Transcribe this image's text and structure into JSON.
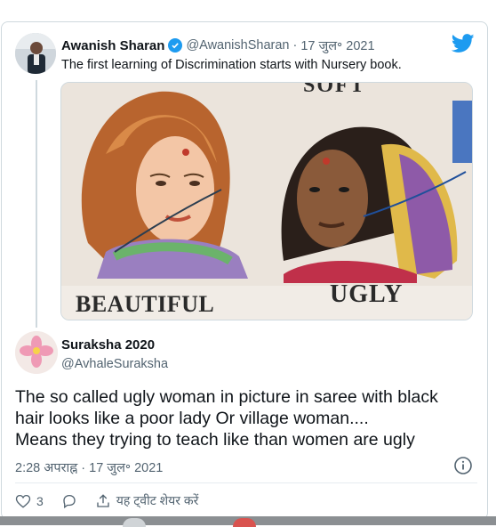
{
  "tweet": {
    "author_name": "Awanish Sharan",
    "author_handle": "@AwanishSharan",
    "separator": "·",
    "date": "17 जुल॰ 2021",
    "text": "The first learning of Discrimination starts with Nursery book.",
    "image_words": {
      "top": "SOFT",
      "left": "BEAUTIFUL",
      "right": "UGLY"
    }
  },
  "reply": {
    "author_name": "Suraksha 2020",
    "author_handle": "@AvhaleSuraksha",
    "lines": [
      "The so called ugly woman in picture  in saree with black",
      "hair looks like a poor lady Or village woman....",
      "Means they trying to teach like than women are  ugly"
    ],
    "timestamp": "2:28 अपराह्न · 17 जुल॰ 2021",
    "like_count": "3",
    "share_label": "यह ट्वीट शेयर करें"
  },
  "icons": [
    "twitter-bird-icon",
    "verified-badge-icon",
    "info-icon",
    "heart-icon",
    "reply-icon",
    "share-icon"
  ],
  "colors": {
    "accent": "#1d9bf0",
    "text": "#0f1419",
    "muted": "#536471",
    "border": "#cfd9de"
  }
}
